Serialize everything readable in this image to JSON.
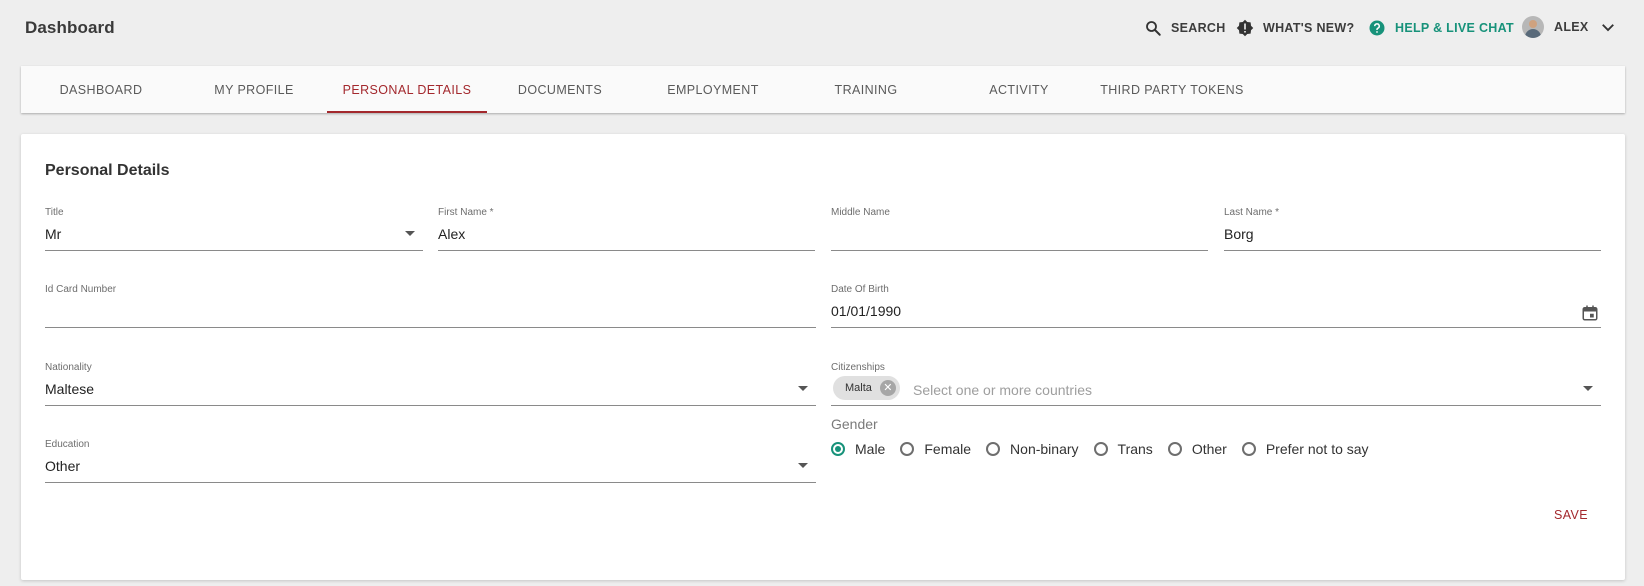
{
  "app": {
    "title": "Dashboard"
  },
  "topbar": {
    "search_label": "SEARCH",
    "whats_new_label": "WHAT'S NEW?",
    "help_label": "HELP & LIVE CHAT",
    "user_name": "ALEX",
    "help_color": "#17927a"
  },
  "tabs": [
    {
      "label": "DASHBOARD",
      "active": false
    },
    {
      "label": "MY PROFILE",
      "active": false
    },
    {
      "label": "PERSONAL DETAILS",
      "active": true
    },
    {
      "label": "DOCUMENTS",
      "active": false
    },
    {
      "label": "EMPLOYMENT",
      "active": false
    },
    {
      "label": "TRAINING",
      "active": false
    },
    {
      "label": "ACTIVITY",
      "active": false
    },
    {
      "label": "THIRD PARTY TOKENS",
      "active": false
    }
  ],
  "form": {
    "heading": "Personal Details",
    "title": {
      "label": "Title",
      "value": "Mr"
    },
    "first_name": {
      "label": "First Name *",
      "value": "Alex"
    },
    "middle_name": {
      "label": "Middle Name",
      "value": ""
    },
    "last_name": {
      "label": "Last Name *",
      "value": "Borg"
    },
    "id_card": {
      "label": "Id Card Number",
      "value": ""
    },
    "dob": {
      "label": "Date Of Birth",
      "value": "01/01/1990"
    },
    "nationality": {
      "label": "Nationality",
      "value": "Maltese"
    },
    "citizenships": {
      "label": "Citizenships",
      "chips": [
        "Malta"
      ],
      "placeholder": "Select one or more countries"
    },
    "education": {
      "label": "Education",
      "value": "Other"
    },
    "gender": {
      "label": "Gender",
      "options": [
        "Male",
        "Female",
        "Non-binary",
        "Trans",
        "Other",
        "Prefer not to say"
      ],
      "selected": "Male"
    },
    "save_label": "SAVE"
  },
  "colors": {
    "accent": "#a3282d",
    "radio": "#17927a"
  }
}
